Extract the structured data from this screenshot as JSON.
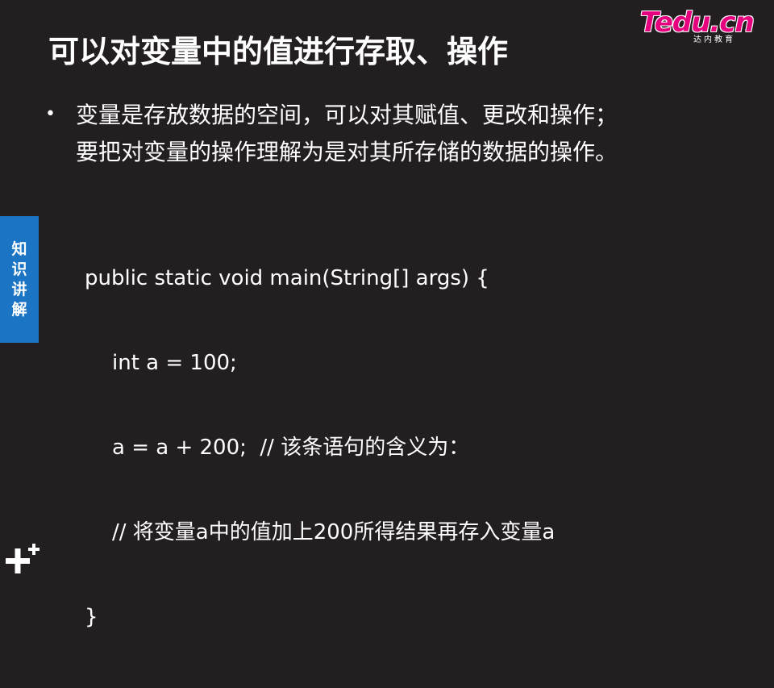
{
  "logo": {
    "brand": "Tedu.cn",
    "sub": "达内教育"
  },
  "title": "可以对变量中的值进行存取、操作",
  "bullet": {
    "line1": "变量是存放数据的空间，可以对其赋值、更改和操作；",
    "line2": "要把对变量的操作理解为是对其所存储的数据的操作。"
  },
  "code": {
    "lines": [
      "public static void main(String[] args) {",
      "int a = 100;",
      "a = a + 200;  // 该条语句的含义为：",
      "// 将变量a中的值加上200所得结果再存入变量a",
      "}"
    ]
  },
  "side_tab": {
    "chars": [
      "知",
      "识",
      "讲",
      "解"
    ]
  },
  "colors": {
    "background": "#231f20",
    "side_tab": "#1b74c4",
    "logo": "#e6007e",
    "text": "#ffffff"
  },
  "icons": {
    "corner": "plus-icon"
  }
}
